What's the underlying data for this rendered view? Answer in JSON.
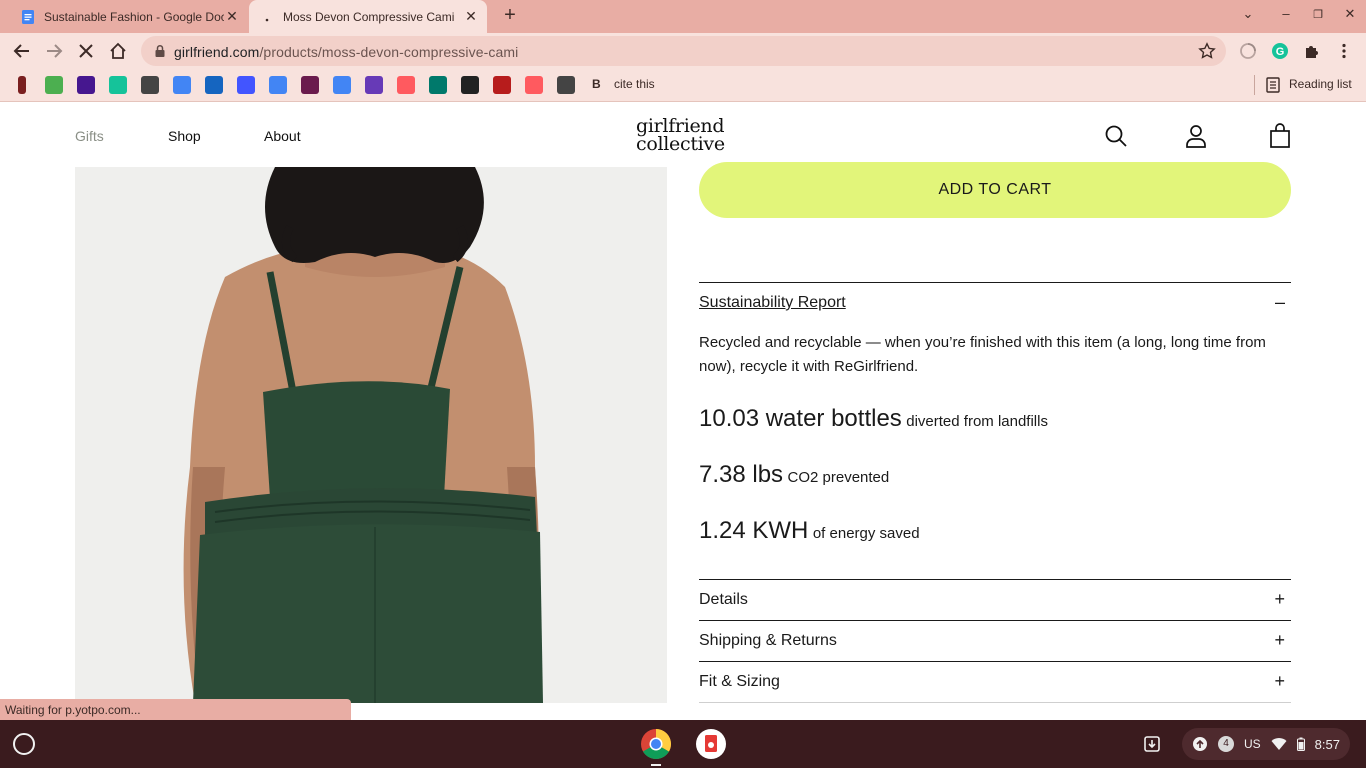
{
  "browser": {
    "tabs": [
      {
        "title": "Sustainable Fashion - Google Docs",
        "icon": "google-docs-icon",
        "active": false
      },
      {
        "title": "Moss Devon Compressive Cami",
        "icon": "loading-icon",
        "active": true
      }
    ],
    "url_host": "girlfriend.com",
    "url_path": "/products/moss-devon-compressive-cami",
    "bookmarks": [
      {
        "icon": "bookmark-red-icon",
        "color": "#7a1f1f"
      },
      {
        "icon": "bookmark-c-icon",
        "color": "#4caf50"
      },
      {
        "icon": "bookmark-k-icon",
        "color": "#46178f"
      },
      {
        "icon": "grammarly-icon",
        "color": "#15c39a"
      },
      {
        "icon": "bike-icon",
        "color": "#444444"
      },
      {
        "icon": "docs-icon",
        "color": "#4285f4"
      },
      {
        "icon": "blue-app-icon",
        "color": "#1565c0"
      },
      {
        "icon": "quizlet-icon",
        "color": "#4255ff"
      },
      {
        "icon": "docs-icon",
        "color": "#4285f4"
      },
      {
        "icon": "grid-app-icon",
        "color": "#6a1b4d"
      },
      {
        "icon": "docs-icon",
        "color": "#4285f4"
      },
      {
        "icon": "forms-icon",
        "color": "#673ab7"
      },
      {
        "icon": "airbnb-icon",
        "color": "#ff5a5f"
      },
      {
        "icon": "wave-icon",
        "color": "#00796b"
      },
      {
        "icon": "dark-circle-icon",
        "color": "#222222"
      },
      {
        "icon": "bird-icon",
        "color": "#b71c1c"
      },
      {
        "icon": "airbnb-icon",
        "color": "#ff5a5f"
      },
      {
        "icon": "v-icon",
        "color": "#444444"
      },
      {
        "icon": "bold-b-icon",
        "color": "#222222"
      }
    ],
    "bookmark_cite": "cite this",
    "reading_list": "Reading list",
    "status_text": "Waiting for p.yotpo.com..."
  },
  "site": {
    "nav": {
      "gifts": "Gifts",
      "shop": "Shop",
      "about": "About"
    },
    "logo_line1": "girlfriend",
    "logo_line2": "collective",
    "add_to_cart": "ADD TO CART",
    "sustainability": {
      "title": "Sustainability Report",
      "toggle": "–",
      "description": "Recycled and recyclable — when you’re finished with this item (a long, long time from now), recycle it with ReGirlfriend.",
      "stats": [
        {
          "value": "10.03 water bottles",
          "label": "diverted from landfills"
        },
        {
          "value": "7.38 lbs",
          "label": "CO2 prevented"
        },
        {
          "value": "1.24 KWH",
          "label": "of energy saved"
        }
      ]
    },
    "accordions": [
      {
        "label": "Details",
        "toggle": "+"
      },
      {
        "label": "Shipping & Returns",
        "toggle": "+"
      },
      {
        "label": "Fit & Sizing",
        "toggle": "+"
      }
    ],
    "accent_color": "#e2f57a"
  },
  "shelf": {
    "notifications": "4",
    "locale": "US",
    "time": "8:57"
  }
}
